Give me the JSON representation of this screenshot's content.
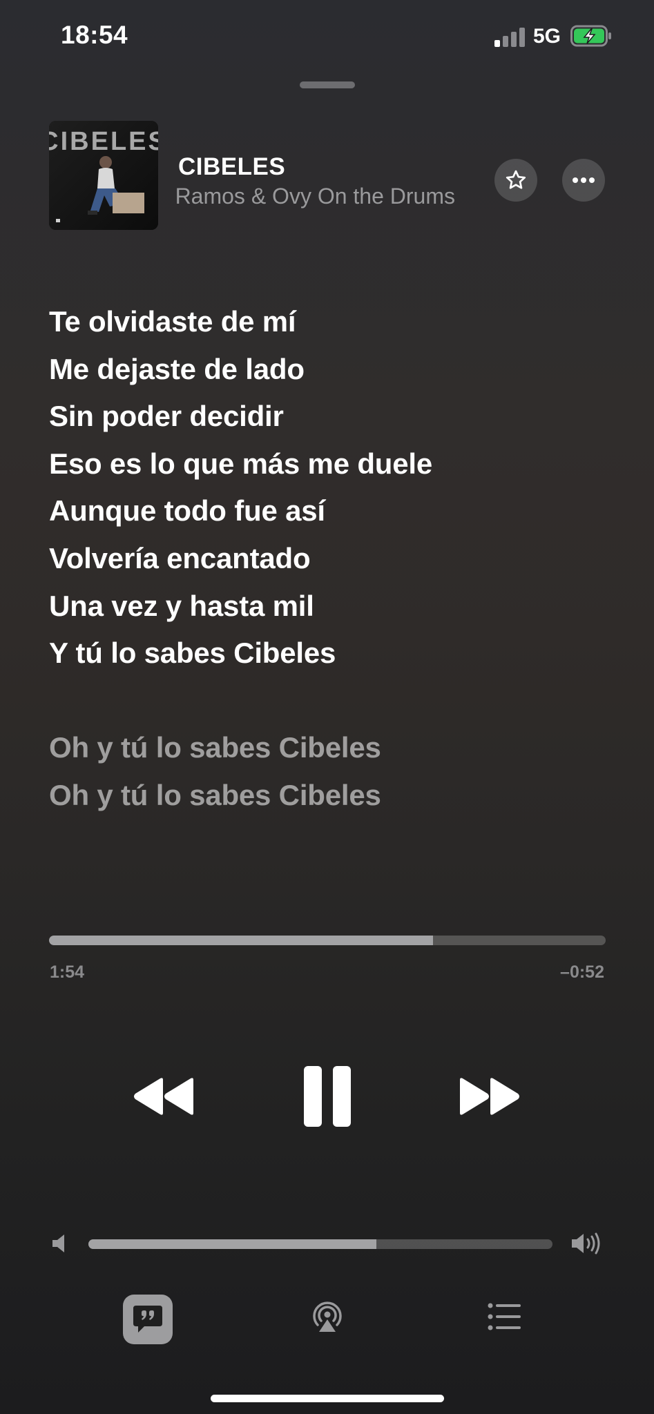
{
  "status_bar": {
    "time": "18:54",
    "network": "5G",
    "battery_charging": true,
    "battery_color": "#34c759"
  },
  "now_playing": {
    "title": "CIBELES",
    "artist_visible": "Ramos & Ovy On the Drums",
    "artwork_text": "CIBELES",
    "favorite_icon": "star-outline-icon",
    "more_icon": "ellipsis-icon"
  },
  "lyrics": {
    "active_block": [
      "Te olvidaste de mí",
      "Me dejaste de lado",
      "Sin poder decidir",
      "Eso es lo que más me duele",
      "Aunque todo fue así",
      "Volvería encantado",
      "Una vez y hasta mil",
      "Y tú lo sabes Cibeles"
    ],
    "upcoming_block": [
      "Oh y tú lo sabes Cibeles",
      "Oh y tú lo sabes Cibeles"
    ]
  },
  "playback": {
    "elapsed": "1:54",
    "remaining": "–0:52",
    "progress_fraction": 0.69,
    "state": "playing"
  },
  "volume": {
    "level_fraction": 0.62
  },
  "toolbar": {
    "lyrics_active": true,
    "items": [
      "lyrics-icon",
      "airplay-icon",
      "queue-icon"
    ]
  }
}
